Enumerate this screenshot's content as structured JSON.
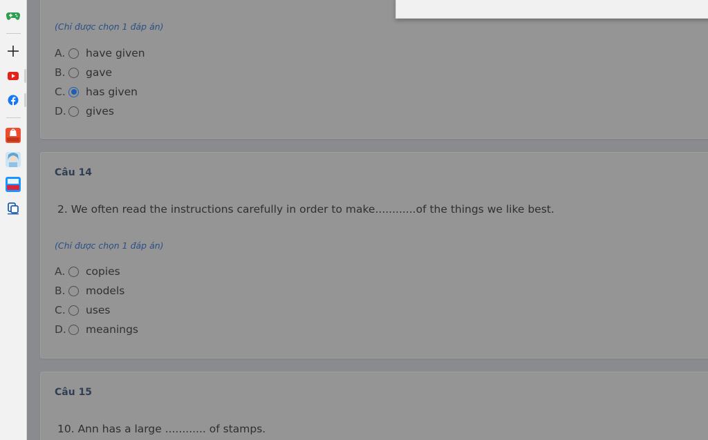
{
  "sidebar": {
    "items": [
      {
        "name": "gamepad-icon",
        "color": "#2e9e4f"
      },
      {
        "name": "add-icon",
        "color": "#222222"
      },
      {
        "name": "youtube-icon",
        "color": "#e62117"
      },
      {
        "name": "facebook-icon",
        "color": "#1877f2"
      },
      {
        "name": "shopee-icon",
        "color": "#ee4d2d",
        "badge": "11.11"
      },
      {
        "name": "avatar-app-icon",
        "color": "#5aa7d6"
      },
      {
        "name": "tiki-icon",
        "color": "#1a94ff",
        "badge": "11.11"
      },
      {
        "name": "app-icon",
        "color": "#1b5fb0"
      }
    ]
  },
  "questions": [
    {
      "hint": "(Chỉ được chọn 1 đáp án)",
      "options": [
        {
          "letter": "A.",
          "text": "have given",
          "checked": false
        },
        {
          "letter": "B.",
          "text": "gave",
          "checked": false
        },
        {
          "letter": "C.",
          "text": "has given",
          "checked": true
        },
        {
          "letter": "D.",
          "text": "gives",
          "checked": false
        }
      ]
    },
    {
      "title": "Câu 14",
      "text": "2. We often read the instructions carefully in order to make............of the things we like best.",
      "hint": "(Chỉ được chọn 1 đáp án)",
      "options": [
        {
          "letter": "A.",
          "text": "copies",
          "checked": false
        },
        {
          "letter": "B.",
          "text": "models",
          "checked": false
        },
        {
          "letter": "C.",
          "text": "uses",
          "checked": false
        },
        {
          "letter": "D.",
          "text": "meanings",
          "checked": false
        }
      ]
    },
    {
      "title": "Câu 15",
      "text": "10. Ann has a large ............ of stamps."
    }
  ],
  "colors": {
    "accent": "#1e5fb4",
    "hint": "#2a4f86",
    "title": "#2f3f52"
  }
}
